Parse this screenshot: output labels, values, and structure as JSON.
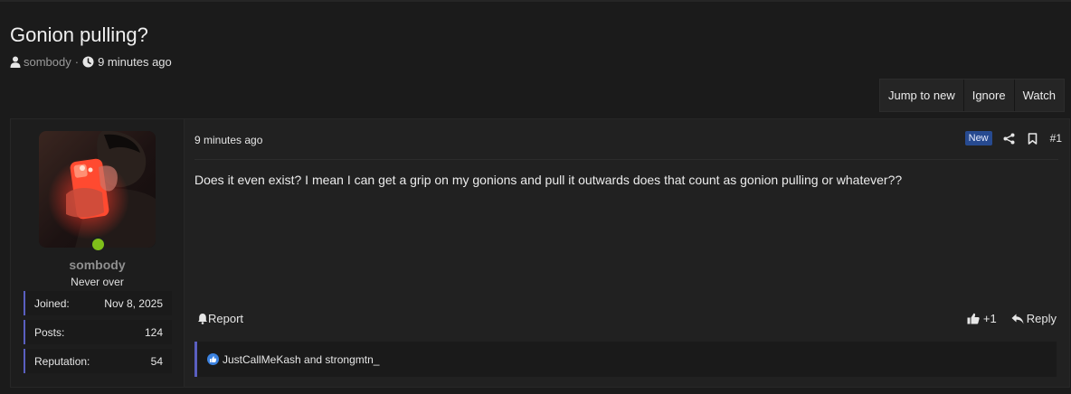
{
  "thread": {
    "title": "Gonion pulling?",
    "author": "sombody",
    "separator": "·",
    "time": "9 minutes ago"
  },
  "actions": {
    "jump_to_new": "Jump to new",
    "ignore": "Ignore",
    "watch": "Watch"
  },
  "post": {
    "user": {
      "name": "sombody",
      "title": "Never over",
      "stats": [
        {
          "label": "Joined:",
          "value": "Nov 8, 2025"
        },
        {
          "label": "Posts:",
          "value": "124"
        },
        {
          "label": "Reputation:",
          "value": "54"
        }
      ],
      "online_color": "#7fbf1a"
    },
    "date": "9 minutes ago",
    "badge": "New",
    "number": "#1",
    "body": "Does it even exist? I mean I can get a grip on my gonions and pull it outwards does that count as gonion pulling or whatever??",
    "report_label": "Report",
    "reaction_count": "+1",
    "reply_label": "Reply",
    "reacted_by": "JustCallMeKash and strongmtn_"
  },
  "icons": {
    "author": "user-icon",
    "time": "clock-icon",
    "share": "share-icon",
    "bookmark": "bookmark-icon",
    "report": "bell-icon",
    "like": "thumbs-up-icon",
    "reply": "reply-icon",
    "reaction": "like-reaction-icon"
  },
  "colors": {
    "accent": "#5a5fc0",
    "badge": "#274a90",
    "background": "#1b1b1b"
  }
}
